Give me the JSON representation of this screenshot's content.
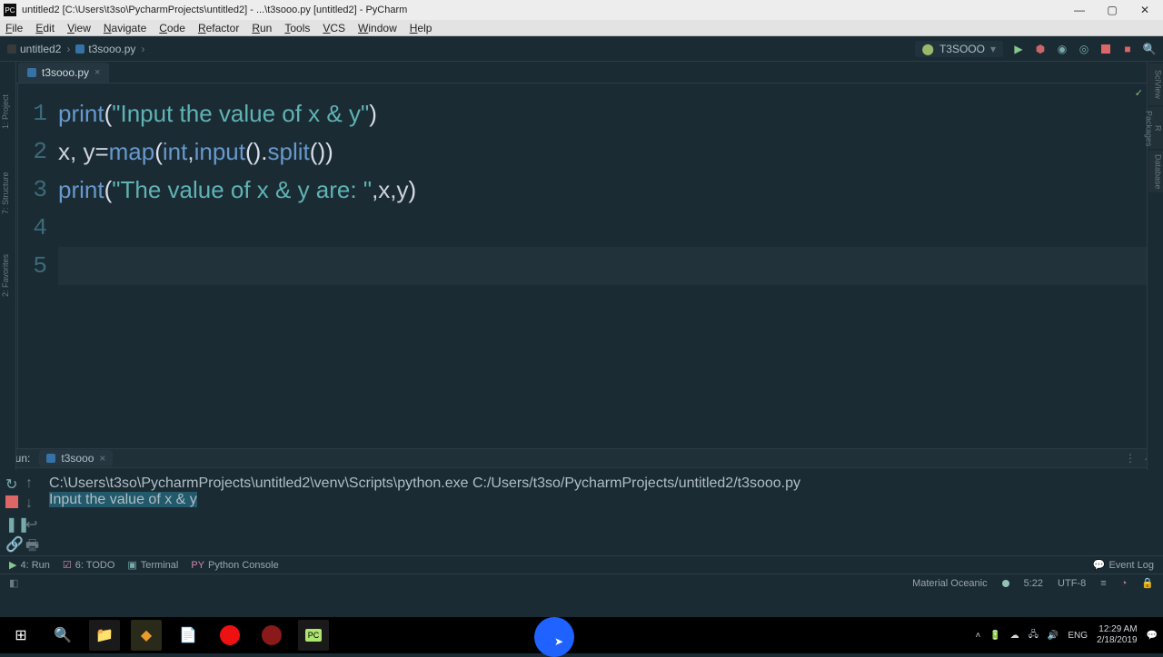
{
  "window": {
    "title": "untitled2 [C:\\Users\\t3so\\PycharmProjects\\untitled2] - ...\\t3sooo.py [untitled2] - PyCharm"
  },
  "menu": {
    "items": [
      "File",
      "Edit",
      "View",
      "Navigate",
      "Code",
      "Refactor",
      "Run",
      "Tools",
      "VCS",
      "Window",
      "Help"
    ]
  },
  "breadcrumb": {
    "project": "untitled2",
    "file": "t3sooo.py"
  },
  "run_config": {
    "name": "T3SOOO"
  },
  "tabs": {
    "file": "t3sooo.py"
  },
  "code": {
    "lines": [
      1,
      2,
      3,
      4,
      5
    ],
    "l1": {
      "fn": "print",
      "open": "(",
      "str": "\"Input the value of x & y\"",
      "close": ")"
    },
    "l2": {
      "xy": "x, y",
      "eq": " = ",
      "map": "map",
      "open": "(",
      "int": "int",
      "comma": ", ",
      "input": "input",
      "unit": "().",
      "split": "split",
      "close": "())"
    },
    "l3": {
      "fn": "print",
      "open": "(",
      "str": "\"The value of x & y are: \"",
      "args": ",x,y",
      "close": ")"
    }
  },
  "run_panel": {
    "label": "Run:",
    "tab": "t3sooo",
    "cmd": "C:\\Users\\t3so\\PycharmProjects\\untitled2\\venv\\Scripts\\python.exe C:/Users/t3so/PycharmProjects/untitled2/t3sooo.py",
    "out": "Input the value of x & y"
  },
  "bottom_tools": {
    "run": "4: Run",
    "todo": "6: TODO",
    "terminal": "Terminal",
    "py": "Python Console",
    "event": "Event Log"
  },
  "status": {
    "theme": "Material Oceanic",
    "pos": "5:22",
    "enc": "UTF-8",
    "le": "≡"
  },
  "taskbar": {
    "lang": "ENG",
    "time": "12:29 AM",
    "date": "2/18/2019"
  }
}
